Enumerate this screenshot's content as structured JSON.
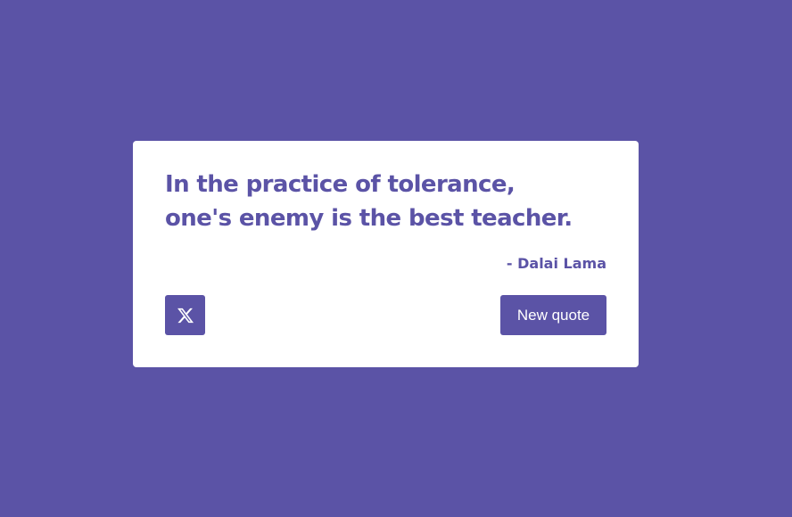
{
  "theme": {
    "accent": "#5b53a6",
    "card_background": "#ffffff",
    "button_text": "#ffffff"
  },
  "quote": {
    "text": "In the practice of tolerance, one's enemy is the best teacher.",
    "author": "- Dalai Lama"
  },
  "actions": {
    "tweet_icon": "x-logo-icon",
    "new_quote_label": "New quote"
  }
}
